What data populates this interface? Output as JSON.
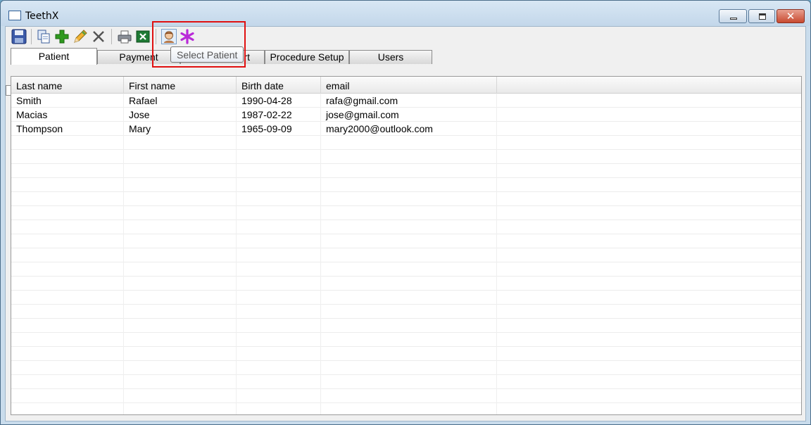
{
  "window": {
    "title": "TeethX"
  },
  "toolbar": {
    "buttons": [
      {
        "icon": "save-icon"
      },
      {
        "icon": "copy-icon"
      },
      {
        "icon": "add-icon"
      },
      {
        "icon": "edit-pencil-icon"
      },
      {
        "icon": "delete-x-icon"
      },
      {
        "icon": "print-icon"
      },
      {
        "icon": "excel-export-icon"
      },
      {
        "icon": "select-patient-icon"
      },
      {
        "icon": "asterisk-icon"
      }
    ],
    "tooltip": "Select Patient"
  },
  "tabs": [
    {
      "label": "Patient",
      "active": true
    },
    {
      "label": "Payment",
      "active": false
    },
    {
      "label": "rt",
      "active": false
    },
    {
      "label": "Procedure Setup",
      "active": false
    },
    {
      "label": "Users",
      "active": false
    }
  ],
  "grid": {
    "columns": [
      "Last name",
      "First name",
      "Birth date",
      "email",
      ""
    ],
    "rows": [
      [
        "Smith",
        "Rafael",
        "1990-04-28",
        "rafa@gmail.com",
        ""
      ],
      [
        "Macias",
        "Jose",
        "1987-02-22",
        "jose@gmail.com",
        ""
      ],
      [
        "Thompson",
        "Mary",
        "1965-09-09",
        "mary2000@outlook.com",
        ""
      ],
      [
        "",
        "",
        "",
        "",
        ""
      ],
      [
        "",
        "",
        "",
        "",
        ""
      ],
      [
        "",
        "",
        "",
        "",
        ""
      ],
      [
        "",
        "",
        "",
        "",
        ""
      ],
      [
        "",
        "",
        "",
        "",
        ""
      ],
      [
        "",
        "",
        "",
        "",
        ""
      ],
      [
        "",
        "",
        "",
        "",
        ""
      ],
      [
        "",
        "",
        "",
        "",
        ""
      ],
      [
        "",
        "",
        "",
        "",
        ""
      ],
      [
        "",
        "",
        "",
        "",
        ""
      ],
      [
        "",
        "",
        "",
        "",
        ""
      ],
      [
        "",
        "",
        "",
        "",
        ""
      ],
      [
        "",
        "",
        "",
        "",
        ""
      ],
      [
        "",
        "",
        "",
        "",
        ""
      ],
      [
        "",
        "",
        "",
        "",
        ""
      ],
      [
        "",
        "",
        "",
        "",
        ""
      ],
      [
        "",
        "",
        "",
        "",
        ""
      ],
      [
        "",
        "",
        "",
        "",
        ""
      ],
      [
        "",
        "",
        "",
        "",
        ""
      ],
      [
        "",
        "",
        "",
        "",
        ""
      ]
    ]
  },
  "colors": {
    "highlight": "#e01010",
    "add": "#2f9a1f",
    "asterisk": "#b92ad8",
    "save": "#3b5aa8"
  }
}
